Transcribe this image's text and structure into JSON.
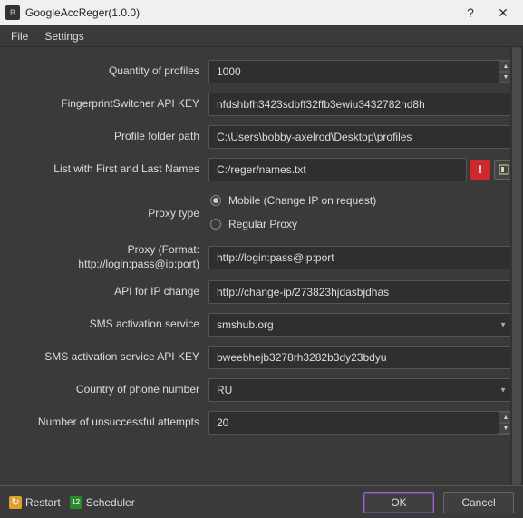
{
  "window": {
    "title": "GoogleAccReger(1.0.0)",
    "help": "?",
    "close": "✕"
  },
  "menu": {
    "file": "File",
    "settings": "Settings"
  },
  "labels": {
    "quantity": "Quantity of profiles",
    "fp_key": "FingerprintSwitcher API KEY",
    "profile_path": "Profile folder path",
    "names_list": "List with First and Last Names",
    "proxy_type": "Proxy type",
    "proxy_fmt": "Proxy (Format: http://login:pass@ip:port)",
    "ip_api": "API for IP change",
    "sms_service": "SMS activation service",
    "sms_key": "SMS activation service API KEY",
    "country": "Country of phone number",
    "attempts": "Number of unsuccessful attempts"
  },
  "values": {
    "quantity": "1000",
    "fp_key": "nfdshbfh3423sdbff32ffb3ewiu3432782hd8h",
    "profile_path": "C:\\Users\\bobby-axelrod\\Desktop\\profiles",
    "names_list": "C:/reger/names.txt",
    "proxy_mobile": "Mobile (Change IP on request)",
    "proxy_regular": "Regular Proxy",
    "proxy_fmt": "http://login:pass@ip:port",
    "ip_api": "http://change-ip/273823hjdasbjdhas",
    "sms_service": "smshub.org",
    "sms_key": "bweebhejb3278rh3282b3dy23bdyu",
    "country": "RU",
    "attempts": "20"
  },
  "footer": {
    "restart": "Restart",
    "scheduler": "Scheduler",
    "ok": "OK",
    "cancel": "Cancel"
  },
  "icons": {
    "error": "!",
    "open": "▯"
  }
}
